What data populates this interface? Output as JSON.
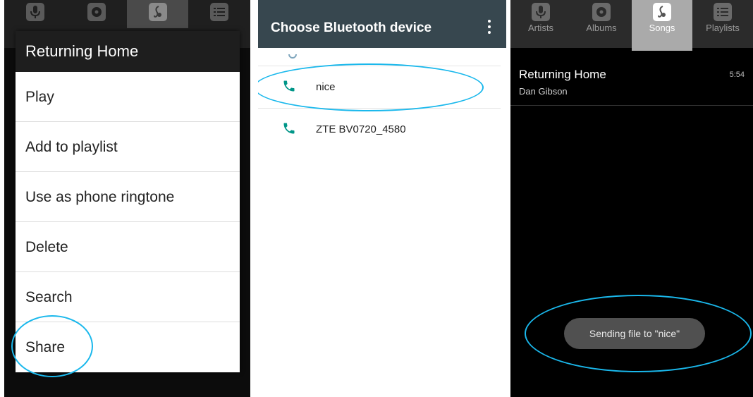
{
  "menu_screen": {
    "dialog_title": "Returning Home",
    "menu_items": [
      {
        "label": "Play"
      },
      {
        "label": "Add to playlist"
      },
      {
        "label": "Use as phone ringtone"
      },
      {
        "label": "Delete"
      },
      {
        "label": "Search"
      },
      {
        "label": "Share"
      }
    ]
  },
  "bluetooth_screen": {
    "title": "Choose Bluetooth device",
    "devices": [
      {
        "name": "nice",
        "icon": "phone-icon"
      },
      {
        "name": "ZTE BV0720_4580",
        "icon": "phone-icon"
      }
    ]
  },
  "songs_screen": {
    "tabs": [
      {
        "label": "Artists",
        "icon": "microphone-icon"
      },
      {
        "label": "Albums",
        "icon": "disc-icon"
      },
      {
        "label": "Songs",
        "icon": "music-note-icon"
      },
      {
        "label": "Playlists",
        "icon": "list-icon"
      }
    ],
    "selected_tab": "Songs",
    "song": {
      "title": "Returning Home",
      "artist": "Dan Gibson",
      "duration": "5:54"
    },
    "toast": "Sending file to \"nice\""
  },
  "colors": {
    "bluetooth_header": "#37474f",
    "phone_icon": "#009688",
    "highlight": "#1ab8ec"
  }
}
